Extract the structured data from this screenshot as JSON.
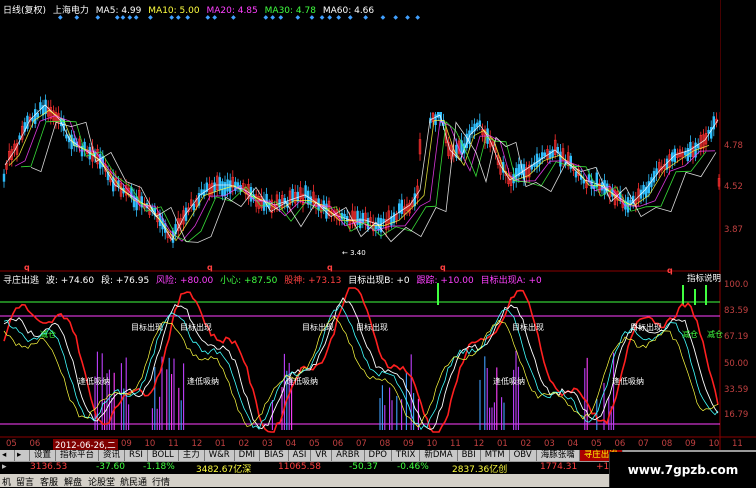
{
  "main_legend": {
    "period": "日线(复权)",
    "stock": "上海电力",
    "ma5": "MA5: 4.99",
    "ma10": "MA10: 5.00",
    "ma20": "MA20: 4.85",
    "ma30": "MA30: 4.78",
    "ma60": "MA60: 4.66"
  },
  "main_axis": {
    "labels": [
      "4.78",
      "4.52",
      "3.87"
    ],
    "low_marker": "← 3.40"
  },
  "q_marks": [
    "q",
    "q",
    "q",
    "q"
  ],
  "indicator_legend": {
    "name": "寻庄出逃",
    "items": [
      {
        "text": "波: +74.60",
        "color": "#ffffff"
      },
      {
        "text": "段: +76.95",
        "color": "#ffffff"
      },
      {
        "text": "风险: +80.00",
        "color": "#ff40ff"
      },
      {
        "text": "小心: +87.50",
        "color": "#40ff40"
      },
      {
        "text": "股神: +73.13",
        "color": "#ff4040"
      },
      {
        "text": "目标出现B: +0",
        "color": "#ffffff"
      },
      {
        "text": "跟踪: +10.00",
        "color": "#ff40ff"
      },
      {
        "text": "目标出现A: +0",
        "color": "#ff40ff"
      }
    ]
  },
  "indicator_axis": {
    "labels": [
      "100.0",
      "83.59",
      "67.19",
      "50.00",
      "33.59",
      "16.79"
    ]
  },
  "indicator_annotations": {
    "corner_q": "q",
    "corner_label": "指标说明",
    "target_labels": [
      "目标出现",
      "目标出现",
      "目标出现",
      "目标出现",
      "目标出现",
      "目标出现"
    ],
    "green_labels": [
      "减仓",
      "减仓",
      "减仓"
    ],
    "white_labels": [
      "逢低吸纳",
      "逢低吸纳",
      "逢低吸纳",
      "逢低吸纳",
      "逢低吸纳"
    ]
  },
  "date_axis": {
    "labels": [
      "05",
      "06",
      "2012-06-26,二",
      "09",
      "10",
      "11",
      "12",
      "01",
      "02",
      "03",
      "04",
      "05",
      "06",
      "07",
      "08",
      "09",
      "10",
      "11",
      "12",
      "01",
      "02",
      "03",
      "04",
      "05",
      "06",
      "07",
      "08",
      "09",
      "10",
      "11"
    ],
    "highlight_index": 2
  },
  "tabs": [
    "设置",
    "指标平台",
    "资讯",
    "RSI",
    "BOLL",
    "主力",
    "W&R",
    "DMI",
    "BIAS",
    "ASI",
    "VR",
    "ARBR",
    "DPO",
    "TRIX",
    "新DMA",
    "BBI",
    "MTM",
    "OBV",
    "海豚张嘴",
    "寻庄出逃"
  ],
  "active_tab": "寻庄出逃",
  "status": {
    "v1": "3136.53",
    "v2": "-37.60",
    "v3": "-1.18%",
    "v4": "3482.67亿深",
    "v5": "11065.58",
    "v6": "-50.37",
    "v7": "-0.46%",
    "v8": "2837.36亿创",
    "v9": "1774.31",
    "v10": "+16"
  },
  "bottom_menu": [
    "机",
    "留言",
    "客服",
    "解盘",
    "论股堂",
    "航民通",
    "行情"
  ],
  "watermark": "www.7gpzb.com",
  "colors": {
    "up": "#ff3030",
    "down": "#30c0ff",
    "ma5": "#ffffff",
    "ma10": "#ffff40",
    "ma20": "#ff40ff",
    "ma30": "#40ff40",
    "ma60": "#ffffff"
  }
}
